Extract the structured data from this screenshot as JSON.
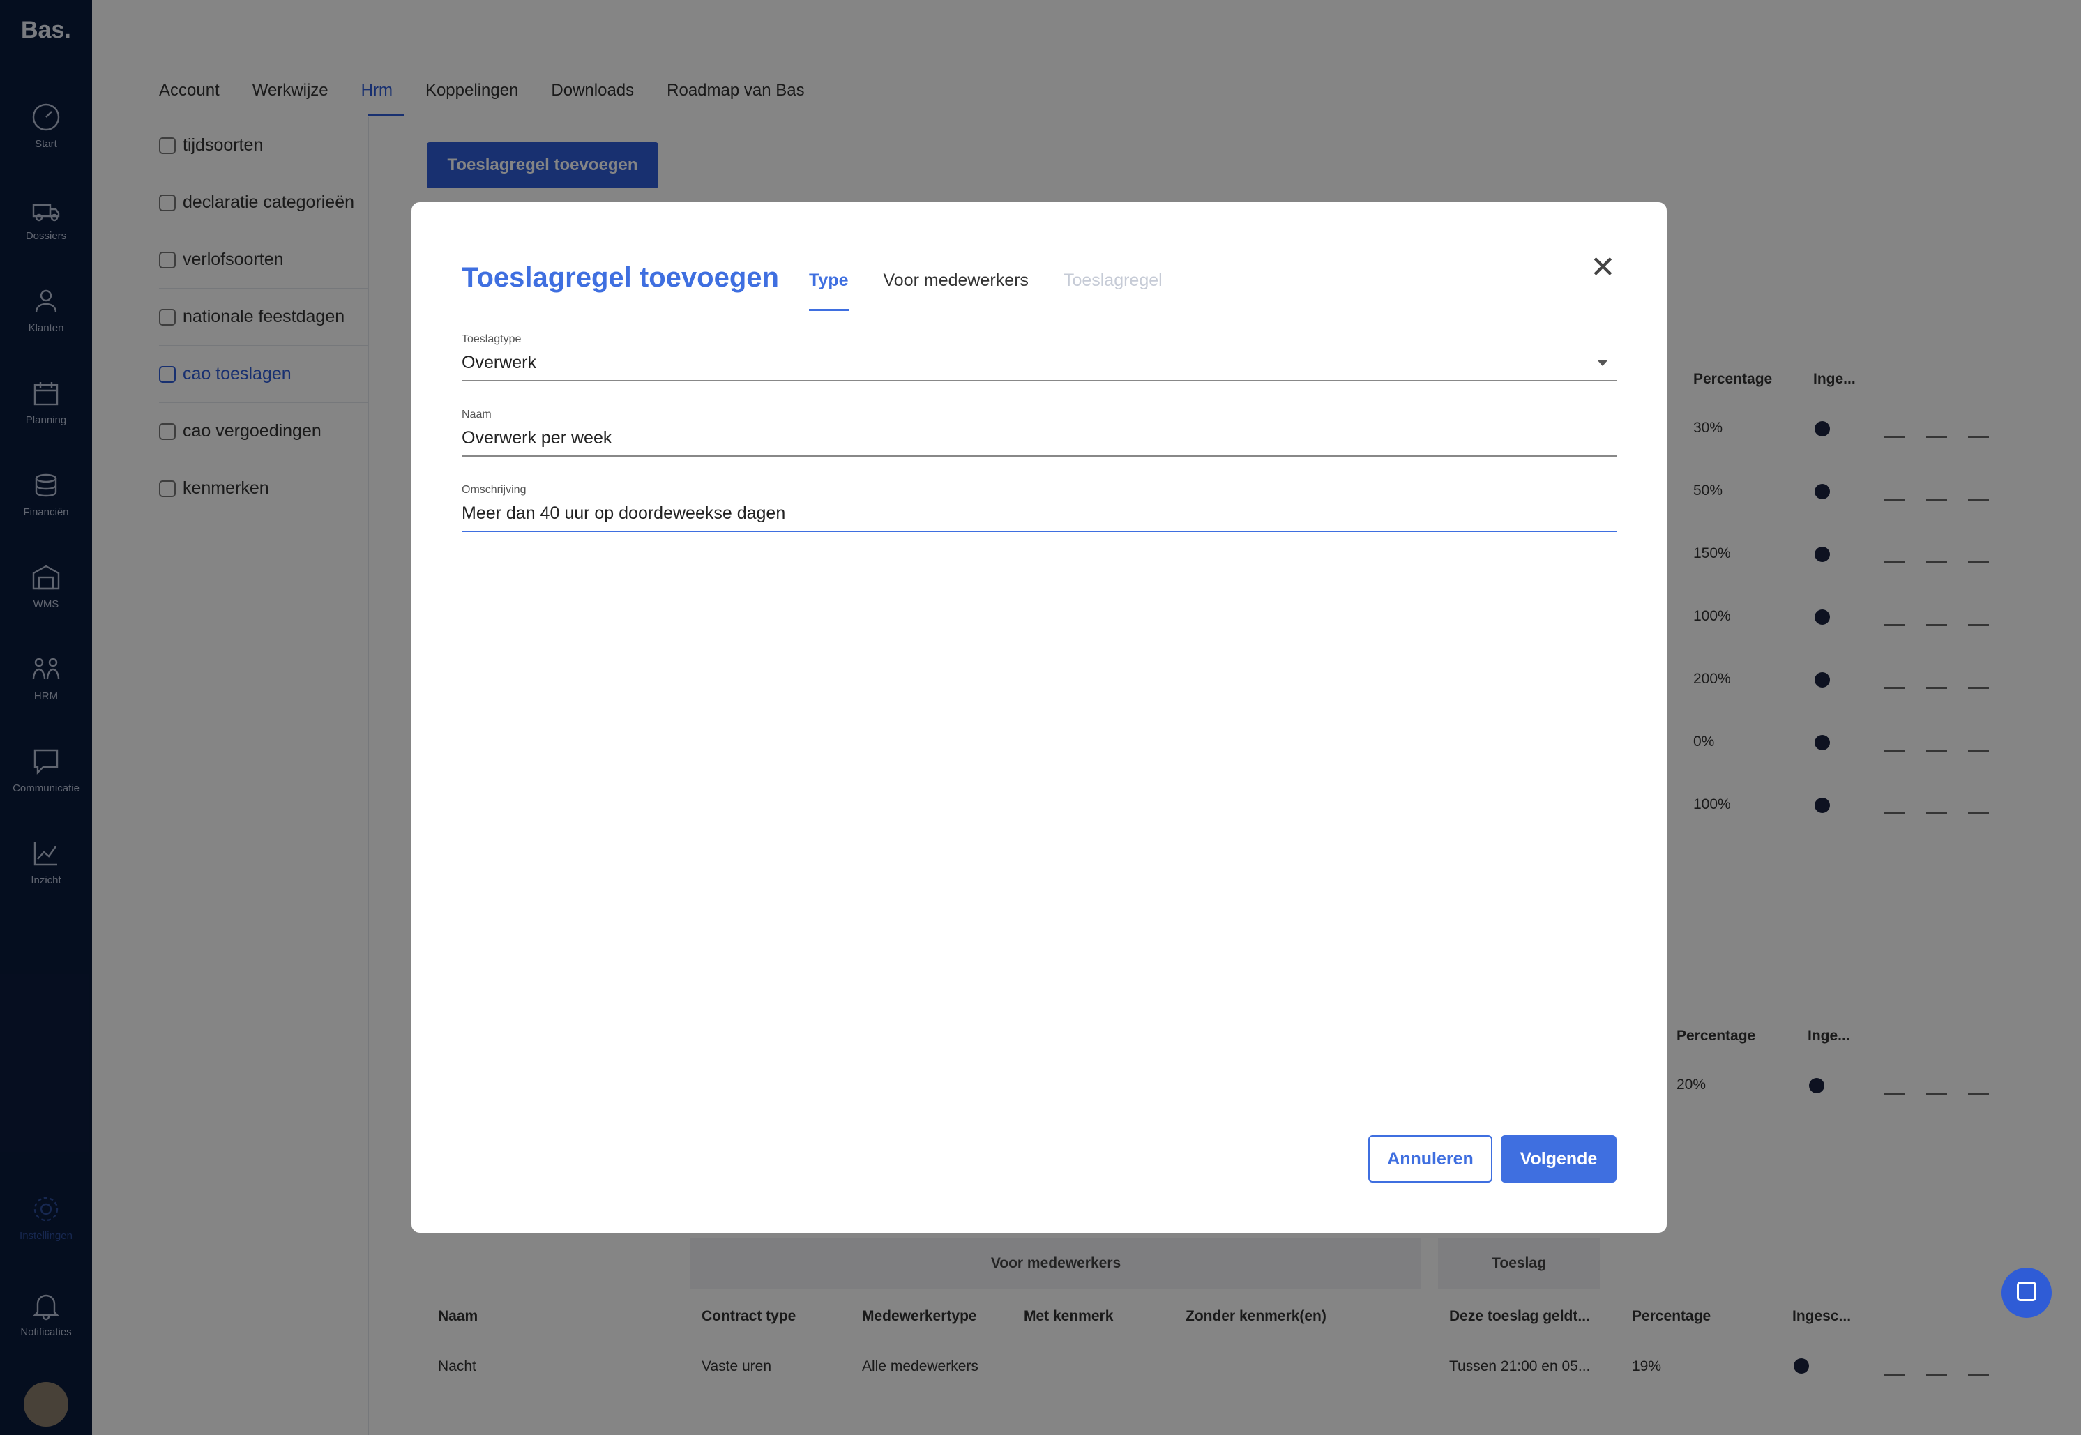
{
  "app": {
    "logo": "Bas."
  },
  "sidebar": {
    "items": [
      {
        "label": "Start",
        "icon": "gauge-icon"
      },
      {
        "label": "Dossiers",
        "icon": "truck-icon"
      },
      {
        "label": "Klanten",
        "icon": "users-icon"
      },
      {
        "label": "Planning",
        "icon": "calendar-icon"
      },
      {
        "label": "Financiën",
        "icon": "coins-icon"
      },
      {
        "label": "WMS",
        "icon": "warehouse-icon"
      },
      {
        "label": "HRM",
        "icon": "team-icon"
      },
      {
        "label": "Communicatie",
        "icon": "chat-icon"
      },
      {
        "label": "Inzicht",
        "icon": "chart-icon"
      }
    ],
    "bottom": [
      {
        "label": "Instellingen",
        "icon": "gear-icon"
      },
      {
        "label": "Notificaties",
        "icon": "bell-icon"
      }
    ]
  },
  "tabs": [
    "Account",
    "Werkwijze",
    "Hrm",
    "Koppelingen",
    "Downloads",
    "Roadmap van Bas"
  ],
  "active_tab": "Hrm",
  "submenu": [
    {
      "label": "tijdsoorten",
      "icon": "clock-icon"
    },
    {
      "label": "declaratie categorieën",
      "icon": "receipt-icon"
    },
    {
      "label": "verlofsoorten",
      "icon": "palm-icon"
    },
    {
      "label": "nationale feestdagen",
      "icon": "flag-icon"
    },
    {
      "label": "cao toeslagen",
      "icon": "percent-icon"
    },
    {
      "label": "cao vergoedingen",
      "icon": "wallet-icon"
    },
    {
      "label": "kenmerken",
      "icon": "people-icon"
    }
  ],
  "active_submenu": "cao toeslagen",
  "add_button": "Toeslagregel toevoegen",
  "table1": {
    "headers": [
      "Percentage",
      "Inge..."
    ],
    "rows": [
      "30%",
      "50%",
      "150%",
      "100%",
      "200%",
      "0%",
      "100%"
    ]
  },
  "table2": {
    "headers": [
      "Percentage",
      "Inge..."
    ],
    "rows": [
      "20%"
    ]
  },
  "table3": {
    "groups": [
      "Voor medewerkers",
      "Toeslag"
    ],
    "headers": [
      "Naam",
      "Contract type",
      "Medewerkertype",
      "Met kenmerk",
      "Zonder kenmerk(en)",
      "Deze toeslag geldt...",
      "Percentage",
      "Ingesc..."
    ],
    "row": [
      "Nacht",
      "Vaste uren",
      "Alle medewerkers",
      "",
      "",
      "Tussen 21:00 en 05...",
      "19%"
    ]
  },
  "modal": {
    "title": "Toeslagregel toevoegen",
    "tabs": [
      "Type",
      "Voor medewerkers",
      "Toeslagregel"
    ],
    "fields": [
      {
        "label": "Toeslagtype",
        "value": "Overwerk"
      },
      {
        "label": "Naam",
        "value": "Overwerk per week"
      },
      {
        "label": "Omschrijving",
        "value": "Meer dan 40 uur op doordeweekse dagen"
      }
    ],
    "cancel": "Annuleren",
    "next": "Volgende"
  }
}
